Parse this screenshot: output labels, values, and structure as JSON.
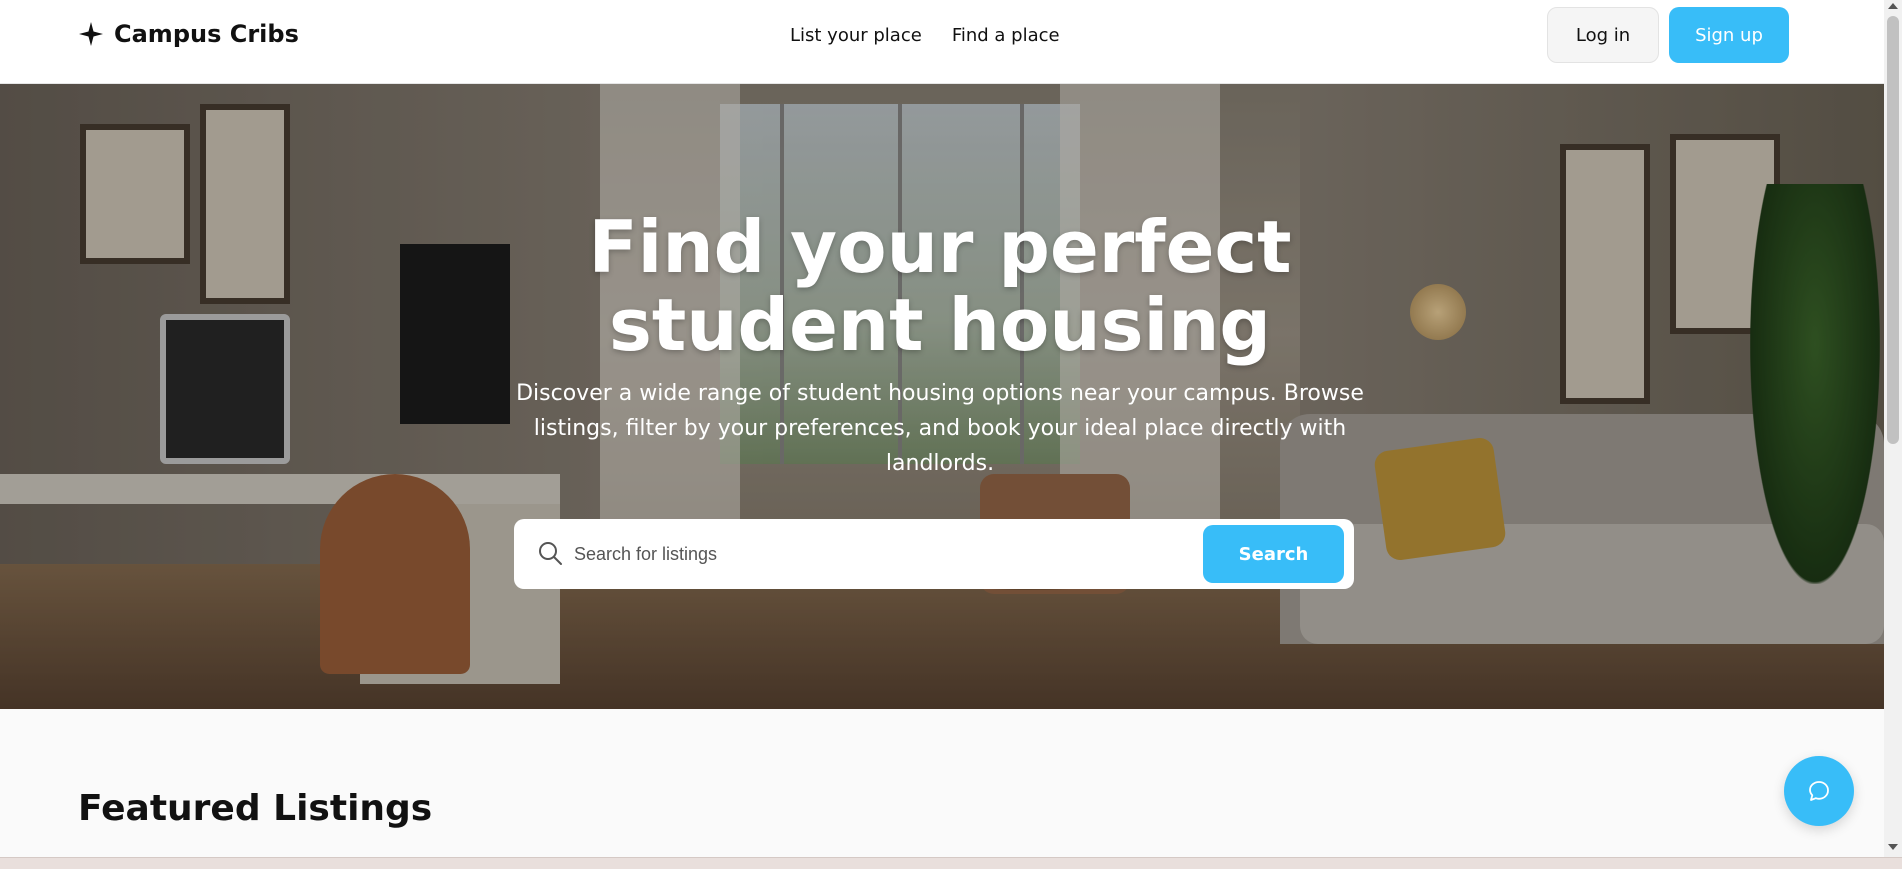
{
  "nav": {
    "brand": "Campus Cribs",
    "links": [
      "List your place",
      "Find a place"
    ],
    "login_label": "Log in",
    "signup_label": "Sign up"
  },
  "hero": {
    "title": "Find your perfect student housing",
    "subtitle": "Discover a wide range of student housing options near your campus. Browse listings, filter by your preferences, and book your ideal place directly with landlords.",
    "search": {
      "placeholder": "Search for listings",
      "button_label": "Search"
    }
  },
  "featured": {
    "title": "Featured Listings"
  },
  "colors": {
    "accent": "#38bdf8",
    "text": "#111111",
    "background": "#fafafa"
  },
  "icons": {
    "brand": "sparkle-icon",
    "search": "search-icon",
    "chat": "chat-bubble-icon"
  }
}
